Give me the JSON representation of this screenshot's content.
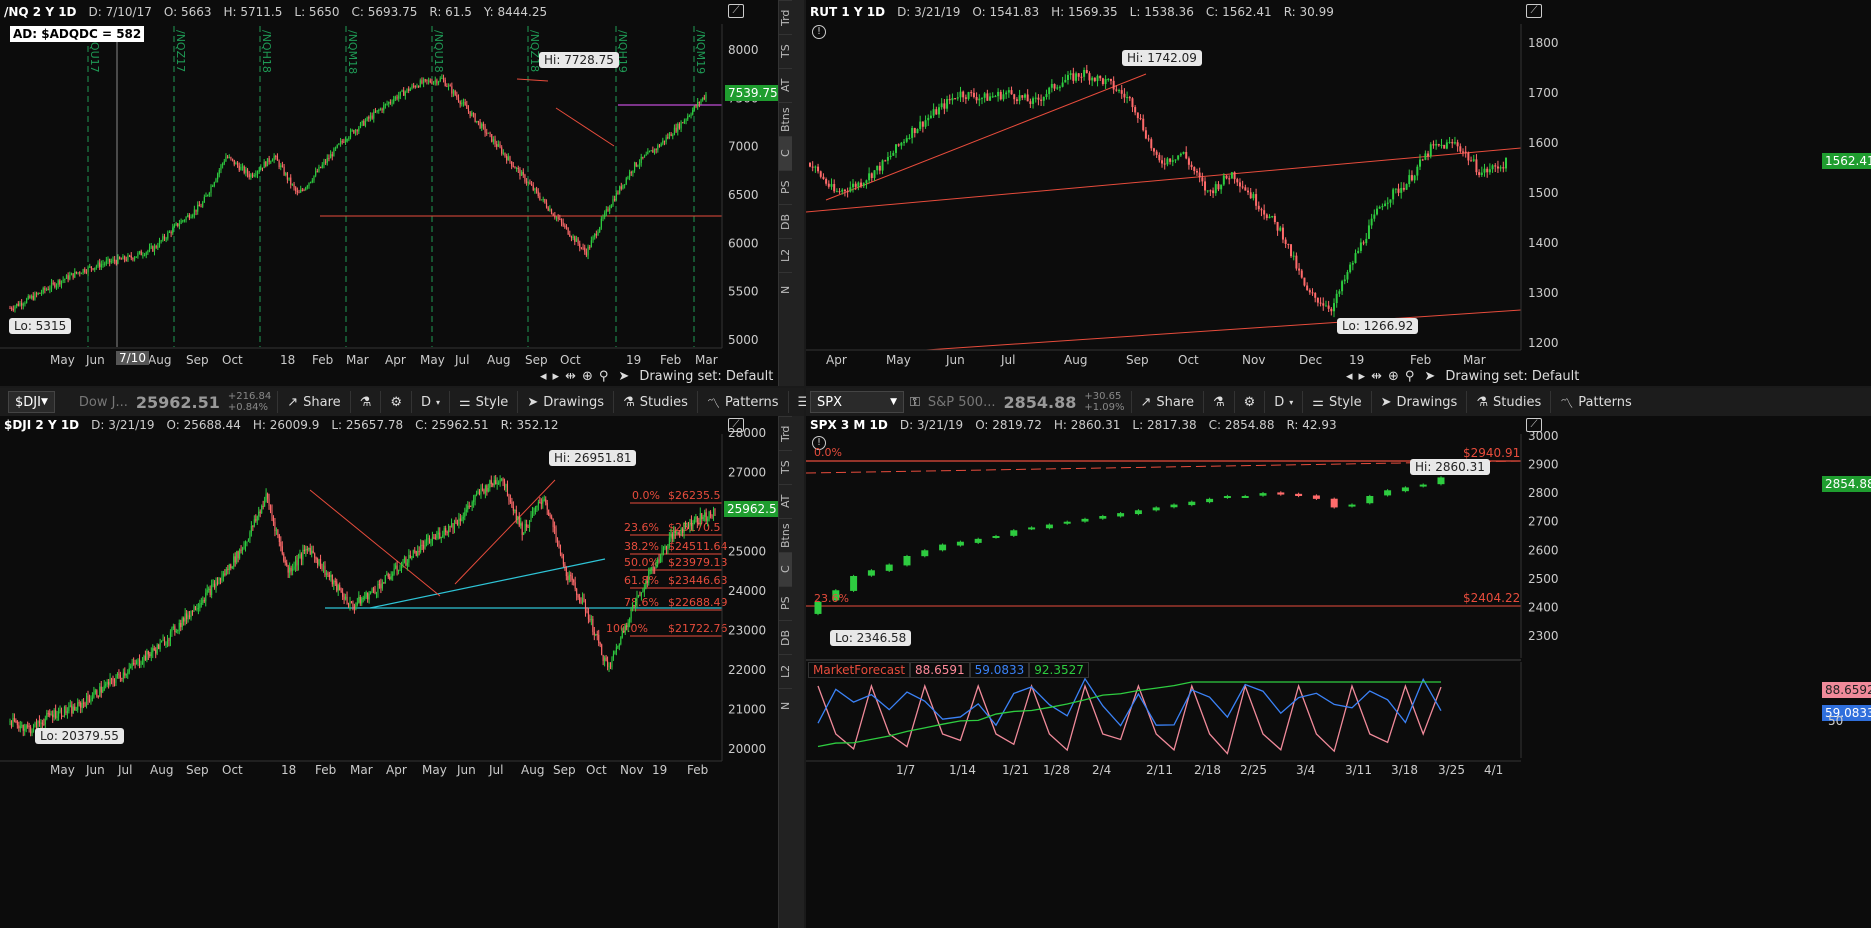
{
  "panes": {
    "nq": {
      "header": {
        "symbol": "/NQ 2 Y 1D",
        "date": "D: 7/10/17",
        "open": "O: 5663",
        "high": "H: 5711.5",
        "low": "L: 5650",
        "close": "C: 5693.75",
        "range": "R: 61.5",
        "y": "Y: 8444.25"
      },
      "ad_label": "AD: $ADQDC = 582",
      "hi_label": "Hi: 7728.75",
      "lo_label": "Lo: 5315",
      "price_box": "7539.75",
      "cursor_date": "7/10",
      "rollovers": [
        "/NQU17",
        "/NQZ17",
        "/NQH18",
        "/NQM18",
        "/NQU18",
        "/NQZ18",
        "/NQH19",
        "/NQM19"
      ],
      "yticks": [
        "8000",
        "7500",
        "7000",
        "6500",
        "6000",
        "5500",
        "5000"
      ],
      "xticks": [
        "May",
        "Jun",
        "Aug",
        "Sep",
        "Oct",
        "18",
        "Feb",
        "Mar",
        "Apr",
        "May",
        "Jul",
        "Aug",
        "Sep",
        "Oct",
        "19",
        "Feb",
        "Mar"
      ],
      "drawing_set": "Drawing set: Default"
    },
    "rut": {
      "header": {
        "symbol": "RUT 1 Y 1D",
        "date": "D: 3/21/19",
        "open": "O: 1541.83",
        "high": "H: 1569.35",
        "low": "L: 1538.36",
        "close": "C: 1562.41",
        "range": "R: 30.99"
      },
      "hi_label": "Hi: 1742.09",
      "lo_label": "Lo: 1266.92",
      "price_box": "1562.41",
      "yticks": [
        "1800",
        "1700",
        "1600",
        "1500",
        "1400",
        "1300",
        "1200"
      ],
      "xticks": [
        "Apr",
        "May",
        "Jun",
        "Jul",
        "Aug",
        "Sep",
        "Oct",
        "Nov",
        "Dec",
        "19",
        "Feb",
        "Mar"
      ],
      "drawing_set": "Drawing set: Default"
    },
    "dji": {
      "toolbar": {
        "symbol": "$DJI",
        "desc": "Dow J...",
        "last": "25962.51",
        "chg1": "+216.84",
        "chg2": "+0.84%",
        "share": "Share",
        "period": "D",
        "style": "Style",
        "drawings": "Drawings",
        "studies": "Studies",
        "patterns": "Patterns"
      },
      "header": {
        "symbol": "$DJI 2 Y 1D",
        "date": "D: 3/21/19",
        "open": "O: 25688.44",
        "high": "H: 26009.9",
        "low": "L: 25657.78",
        "close": "C: 25962.51",
        "range": "R: 352.12"
      },
      "hi_label": "Hi: 26951.81",
      "lo_label": "Lo: 20379.55",
      "price_box": "25962.51",
      "fib": [
        {
          "pct": "0.0%",
          "val": "$26235.5"
        },
        {
          "pct": "23.6%",
          "val": "$25170.5"
        },
        {
          "pct": "38.2%",
          "val": "$24511.64"
        },
        {
          "pct": "50.0%",
          "val": "$23979.13"
        },
        {
          "pct": "61.8%",
          "val": "$23446.63"
        },
        {
          "pct": "78.6%",
          "val": "$22688.49"
        },
        {
          "pct": "100.0%",
          "val": "$21722.76"
        }
      ],
      "yticks": [
        "28000",
        "27000",
        "26000",
        "25000",
        "24000",
        "23000",
        "22000",
        "21000",
        "20000"
      ],
      "xticks": [
        "May",
        "Jun",
        "Jul",
        "Aug",
        "Sep",
        "Oct",
        "18",
        "Feb",
        "Mar",
        "Apr",
        "May",
        "Jun",
        "Jul",
        "Aug",
        "Sep",
        "Oct",
        "Nov",
        "19",
        "Feb",
        "Mar"
      ]
    },
    "spx": {
      "toolbar": {
        "symbol": "SPX",
        "desc": "S&P 500...",
        "last": "2854.88",
        "chg1": "+30.65",
        "chg2": "+1.09%",
        "share": "Share",
        "period": "D",
        "style": "Style",
        "drawings": "Drawings",
        "studies": "Studies",
        "patterns": "Patterns"
      },
      "header": {
        "symbol": "SPX 3 M 1D",
        "date": "D: 3/21/19",
        "open": "O: 2819.72",
        "high": "H: 2860.31",
        "low": "L: 2817.38",
        "close": "C: 2854.88",
        "range": "R: 42.93"
      },
      "hi_label": "Hi: 2860.31",
      "lo_label": "Lo: 2346.58",
      "price_box": "2854.88",
      "fib_top": "$2940.91",
      "fib_bottom": "$2404.22",
      "fib_top_pct": "0.0%",
      "fib_bottom_pct": "23.6%",
      "yticks": [
        "3000",
        "2900",
        "2800",
        "2700",
        "2600",
        "2500",
        "2400",
        "2300"
      ],
      "xticks": [
        "1/7",
        "1/14",
        "1/21",
        "1/28",
        "2/4",
        "2/11",
        "2/18",
        "2/25",
        "3/4",
        "3/11",
        "3/18",
        "3/25",
        "4/1"
      ],
      "study": {
        "name": "MarketForecast",
        "v1": "88.6591",
        "v2": "59.0833",
        "v3": "92.3527",
        "box1": "88.6592",
        "box2": "59.0833",
        "ytick": "50"
      }
    }
  },
  "sidebar_tabs": [
    "Trd",
    "TS",
    "AT",
    "Btns",
    "C",
    "PS",
    "DB",
    "L2",
    "N"
  ],
  "colors": {
    "up": "#2ecc40",
    "down": "#ff6b6b",
    "line": "#e74c3c",
    "cyan": "#2ec4d6",
    "purple": "#c04bd6",
    "rollover": "#1f9a55",
    "price_box": "#1f9d2f"
  },
  "chart_data": [
    {
      "type": "candlestick",
      "title": "/NQ 2 Y 1D",
      "ylim": [
        5000,
        8000
      ],
      "approx_closes": [
        5400,
        5600,
        5800,
        5950,
        6100,
        6400,
        6800,
        7000,
        6400,
        6900,
        7100,
        7300,
        7500,
        7650,
        7400,
        6900,
        6300,
        6700,
        7000,
        7300,
        7540
      ]
    },
    {
      "type": "candlestick",
      "title": "RUT 1 Y 1D",
      "ylim": [
        1200,
        1800
      ],
      "approx_closes": [
        1510,
        1560,
        1620,
        1660,
        1680,
        1700,
        1720,
        1740,
        1690,
        1560,
        1530,
        1400,
        1280,
        1400,
        1480,
        1570,
        1540,
        1562
      ]
    },
    {
      "type": "candlestick",
      "title": "$DJI 2 Y 1D",
      "ylim": [
        20000,
        28000
      ],
      "approx_closes": [
        20600,
        21000,
        21500,
        22000,
        22500,
        23300,
        24500,
        26500,
        24500,
        24000,
        24700,
        25400,
        26000,
        26800,
        25000,
        24000,
        22000,
        24000,
        25500,
        25962
      ]
    },
    {
      "type": "candlestick",
      "title": "SPX 3 M 1D",
      "ylim": [
        2300,
        3000
      ],
      "approx_closes": [
        2420,
        2480,
        2520,
        2560,
        2600,
        2640,
        2660,
        2680,
        2700,
        2720,
        2730,
        2740,
        2760,
        2780,
        2790,
        2800,
        2790,
        2780,
        2790,
        2800,
        2810,
        2820,
        2830,
        2855
      ]
    }
  ]
}
